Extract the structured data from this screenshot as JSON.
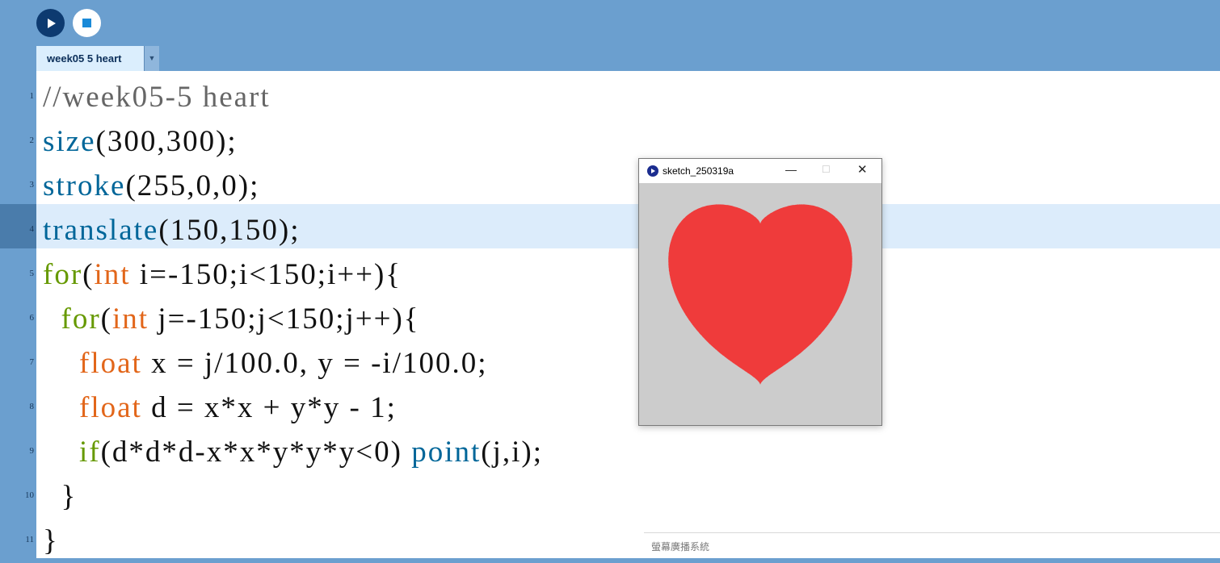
{
  "toolbar": {
    "run_icon": "play-icon",
    "stop_icon": "stop-icon",
    "tab_label": "week05 5 heart",
    "tab_menu_glyph": "▼",
    "accent_color": "#6b9fcf"
  },
  "editor": {
    "line_numbers": [
      "1",
      "2",
      "3",
      "4",
      "5",
      "6",
      "7",
      "8",
      "9",
      "10",
      "11"
    ],
    "highlighted_line": 4,
    "lines": [
      [
        {
          "t": "//week05-5 heart",
          "c": "c-comment"
        }
      ],
      [
        {
          "t": "size",
          "c": "c-fn"
        },
        {
          "t": "(300,300);",
          "c": ""
        }
      ],
      [
        {
          "t": "stroke",
          "c": "c-fn"
        },
        {
          "t": "(255,0,0);",
          "c": ""
        }
      ],
      [
        {
          "t": "translate",
          "c": "c-fn"
        },
        {
          "t": "(150,150);",
          "c": ""
        }
      ],
      [
        {
          "t": "for",
          "c": "c-kw"
        },
        {
          "t": "(",
          "c": ""
        },
        {
          "t": "int",
          "c": "c-type"
        },
        {
          "t": " i=-150;i<150;i++){",
          "c": ""
        }
      ],
      [
        {
          "t": "  ",
          "c": ""
        },
        {
          "t": "for",
          "c": "c-kw"
        },
        {
          "t": "(",
          "c": ""
        },
        {
          "t": "int",
          "c": "c-type"
        },
        {
          "t": " j=-150;j<150;j++){",
          "c": ""
        }
      ],
      [
        {
          "t": "    ",
          "c": ""
        },
        {
          "t": "float",
          "c": "c-type"
        },
        {
          "t": " x = j/100.0, y = -i/100.0;",
          "c": ""
        }
      ],
      [
        {
          "t": "    ",
          "c": ""
        },
        {
          "t": "float",
          "c": "c-type"
        },
        {
          "t": " d = x*x + y*y - 1;",
          "c": ""
        }
      ],
      [
        {
          "t": "    ",
          "c": ""
        },
        {
          "t": "if",
          "c": "c-kw"
        },
        {
          "t": "(d*d*d-x*x*y*y*y<0) ",
          "c": ""
        },
        {
          "t": "point",
          "c": "c-fn"
        },
        {
          "t": "(j,i);",
          "c": ""
        }
      ],
      [
        {
          "t": "  }",
          "c": ""
        }
      ],
      [
        {
          "t": "}",
          "c": ""
        }
      ]
    ]
  },
  "sketch_window": {
    "title": "sketch_250319a",
    "minimize_glyph": "—",
    "maximize_glyph": "☐",
    "close_glyph": "✕",
    "canvas_bg": "#cccccc",
    "heart_color": "#ef3b3b"
  },
  "status_bar": {
    "text": "螢幕廣播系統"
  }
}
